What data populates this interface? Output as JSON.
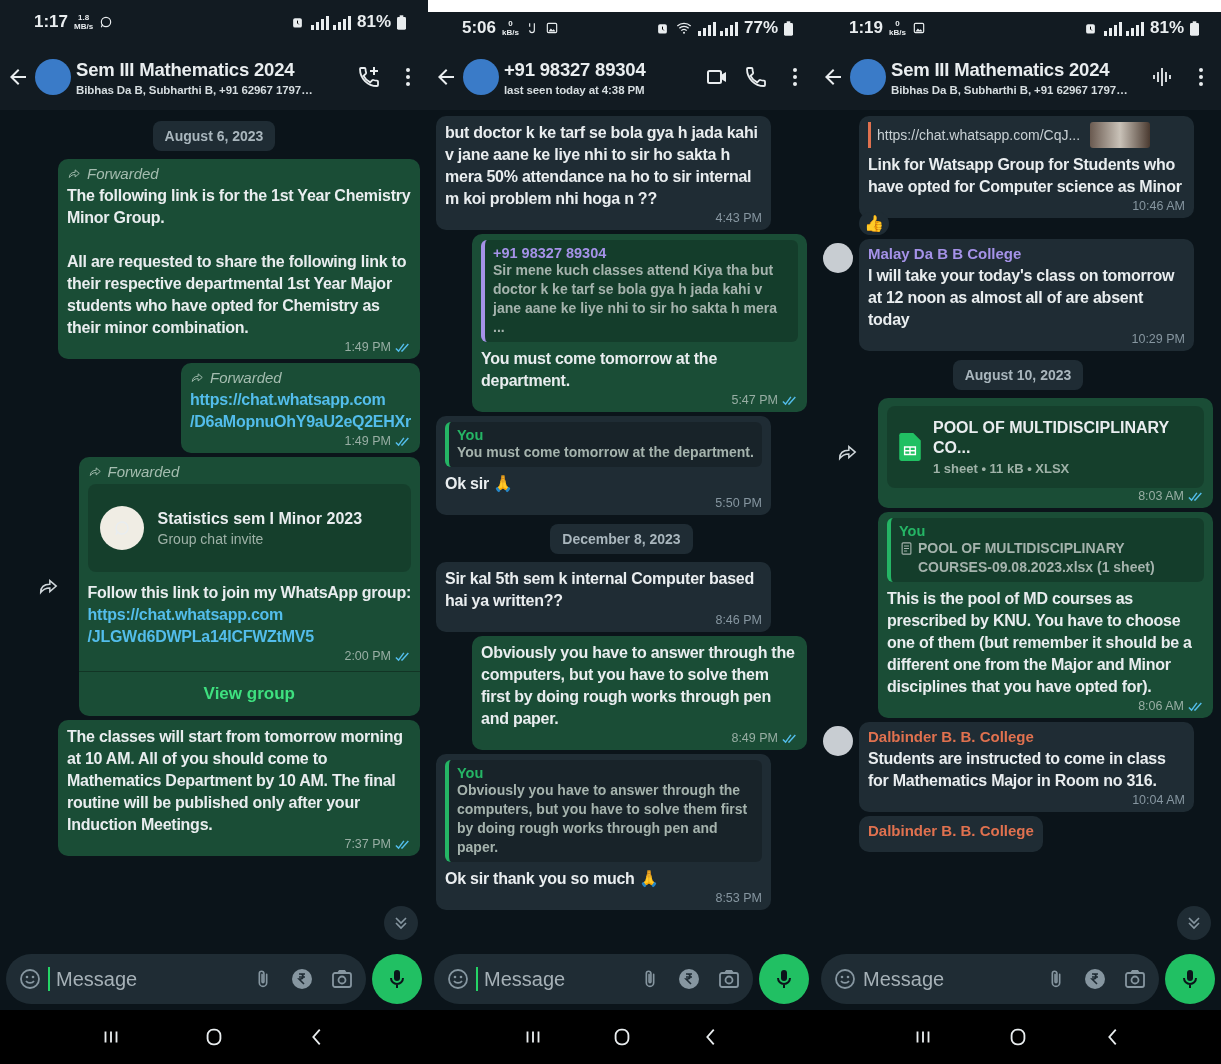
{
  "phones": [
    {
      "status": {
        "time": "1:17",
        "speed_value": "1.8",
        "speed_unit": "MB/s",
        "notification_icons": [
          {
            "kind": "chat"
          }
        ],
        "wifi": false,
        "battery": "81%"
      },
      "header": {
        "title": "Sem III Mathematics 2024",
        "subtitle": "Bibhas Da B, Subharthi B, +91 62967 1797…",
        "actions": [
          {
            "kind": "add-call"
          },
          {
            "kind": "more"
          }
        ]
      },
      "messages": [
        {
          "kind": "date",
          "text": "August 6, 2023"
        },
        {
          "kind": "outgoing",
          "forwarded": "Forwarded",
          "text": "The following link is for the 1st Year Chemistry Minor Group.\n\nAll are requested to share the following link to their respective departmental 1st Year Major students who have opted for Chemistry as their minor combination.",
          "time": "1:49 PM",
          "read": true
        },
        {
          "kind": "outgoing",
          "forwarded": "Forwarded",
          "link": "https://chat.whatsapp.com\n/D6aMopnuOhY9aU2eQ2EHXr",
          "time": "1:49 PM",
          "read": true
        },
        {
          "kind": "outgoing",
          "forward_button": true,
          "forwarded": "Forwarded",
          "invite": {
            "title": "Statistics sem I Minor 2023",
            "subtitle": "Group chat invite"
          },
          "text": "Follow this link to join my WhatsApp group:",
          "link": "https://chat.whatsapp.com\n/JLGWd6DWPLa14ICFWZtMV5",
          "time": "2:00 PM",
          "read": true,
          "action": "View group"
        },
        {
          "kind": "outgoing",
          "text": "The classes will start from tomorrow morning at 10 AM. All of you should come to Mathematics Department by 10 AM. The final routine will be published only after your Induction Meetings.",
          "time": "7:37 PM",
          "read": true
        }
      ],
      "scroll_button": true,
      "composer": {
        "placeholder": "Message",
        "focused": true
      }
    },
    {
      "status": {
        "time": "5:06",
        "speed_value": "0",
        "speed_unit": "kB/s",
        "notification_icons": [
          {
            "kind": "sim"
          },
          {
            "kind": "image"
          }
        ],
        "wifi": true,
        "battery": "77%"
      },
      "header": {
        "title": "+91 98327 89304",
        "subtitle": "last seen today at 4:38 PM",
        "actions": [
          {
            "kind": "video"
          },
          {
            "kind": "call"
          },
          {
            "kind": "more"
          }
        ]
      },
      "messages": [
        {
          "kind": "incoming",
          "text": "but doctor k ke tarf se bola gya h jada kahi v jane aane ke liye nhi to sir ho sakta h mera 50% attendance na ho to sir internal m koi problem nhi hoga n ??",
          "time": "4:43 PM"
        },
        {
          "kind": "outgoing",
          "quote": {
            "author": "+91 98327 89304",
            "color": "#a592e8",
            "text": "Sir mene kuch  classes attend Kiya tha but doctor k ke tarf se bola gya h jada kahi v jane aane ke liye nhi to sir ho sakta h mera ..."
          },
          "text": "You must come tomorrow at the department.",
          "time": "5:47 PM",
          "read": true
        },
        {
          "kind": "incoming",
          "quote": {
            "author": "You",
            "color": "#25b565",
            "text": "You must come tomorrow at the department."
          },
          "text": "Ok sir 🙏",
          "time": "5:50 PM"
        },
        {
          "kind": "date",
          "text": "December 8, 2023"
        },
        {
          "kind": "incoming",
          "text": "Sir kal 5th sem k internal Computer based hai ya written??",
          "time": "8:46 PM"
        },
        {
          "kind": "outgoing",
          "text": "Obviously you have to answer through the computers, but you have to solve them first by doing rough works through pen and paper.",
          "time": "8:49 PM",
          "read": true
        },
        {
          "kind": "incoming",
          "quote": {
            "author": "You",
            "color": "#25b565",
            "text": "Obviously you have to answer through the computers, but you have to solve them first by doing rough works through pen and paper."
          },
          "text": "Ok sir thank you so much 🙏",
          "time": "8:53 PM"
        }
      ],
      "scroll_button": false,
      "composer": {
        "placeholder": "Message",
        "focused": true
      }
    },
    {
      "status": {
        "time": "1:19",
        "speed_value": "0",
        "speed_unit": "kB/s",
        "notification_icons": [
          {
            "kind": "image"
          }
        ],
        "wifi": false,
        "battery": "81%"
      },
      "header": {
        "title": "Sem III Mathematics 2024",
        "subtitle": "Bibhas Da B, Subharthi B, +91 62967 1797…",
        "actions": [
          {
            "kind": "waveform"
          },
          {
            "kind": "more"
          }
        ]
      },
      "messages": [
        {
          "kind": "incoming",
          "preview": {
            "url": "https://chat.whatsapp.com/CqJ..."
          },
          "text": "Link for Watsapp Group for Students who have opted for Computer science as Minor",
          "time": "10:46 AM",
          "reaction": "👍"
        },
        {
          "kind": "incoming",
          "avatar": true,
          "sender": {
            "name": "Malay Da B B College",
            "color": "#a592e8"
          },
          "text": "I will take your today's class on tomorrow at 12 noon as almost all of are absent today",
          "time": "10:29 PM"
        },
        {
          "kind": "date",
          "text": "August 10, 2023"
        },
        {
          "kind": "outgoing",
          "forward_button": true,
          "file": {
            "name": "POOL OF MULTIDISCIPLINARY CO...",
            "meta": "1 sheet • 11 kB • XLSX"
          },
          "time": "8:03 AM",
          "read": true
        },
        {
          "kind": "outgoing",
          "quote": {
            "author": "You",
            "color": "#25b565",
            "text": "POOL OF MULTIDISCIPLINARY COURSES-09.08.2023.xlsx (1 sheet)",
            "document": true
          },
          "text": "This is the pool of MD courses as prescribed by KNU. You have to choose one of them (but remember it should be a different one from the Major and Minor disciplines that you have opted for).",
          "time": "8:06 AM",
          "read": true
        },
        {
          "kind": "incoming",
          "avatar": true,
          "sender": {
            "name": "Dalbinder B. B. College",
            "color": "#e0714f"
          },
          "text": "Students are instructed to come in class for Mathematics Major in Room no 316.",
          "time": "10:04 AM"
        },
        {
          "kind": "incoming",
          "sender": {
            "name": "Dalbinder B. B. College",
            "color": "#e0714f"
          }
        }
      ],
      "scroll_button": true,
      "composer": {
        "placeholder": "Message",
        "focused": false
      }
    }
  ]
}
